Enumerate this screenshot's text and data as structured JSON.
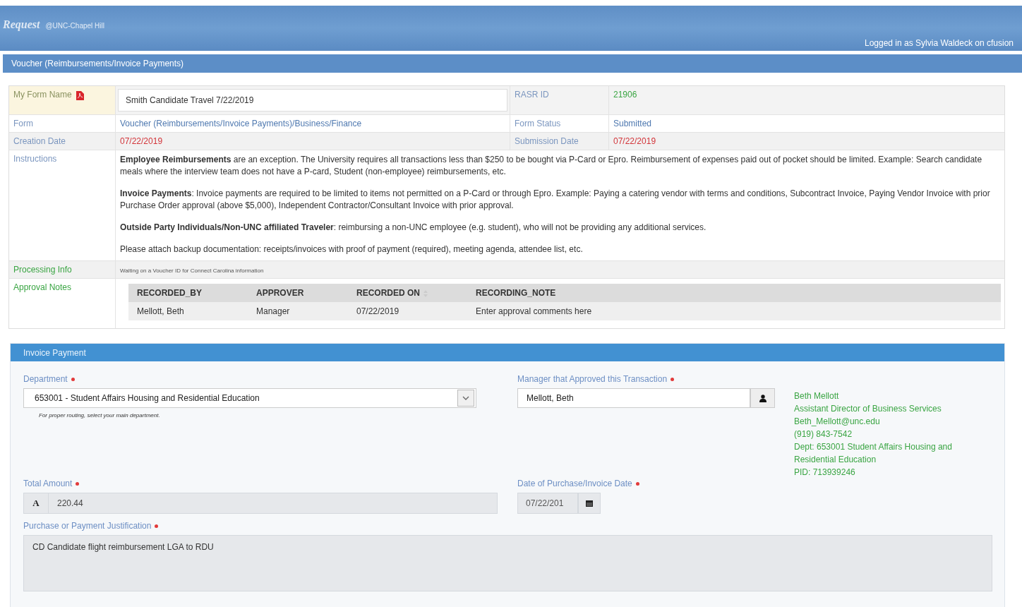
{
  "header": {
    "title": "Request",
    "subtitle": "@UNC-Chapel Hill",
    "user_status": "Logged in as Sylvia Waldeck on cfusion"
  },
  "page_title": "Voucher (Reimbursements/Invoice Payments)",
  "form_info": {
    "my_form_name": {
      "label": "My Form Name",
      "value": "Smith Candidate Travel 7/22/2019"
    },
    "rasr_id": {
      "label": "RASR ID",
      "value": "21906"
    },
    "form": {
      "label": "Form",
      "value": "Voucher (Reimbursements/Invoice Payments)/Business/Finance"
    },
    "form_status": {
      "label": "Form Status",
      "value": "Submitted"
    },
    "creation_date": {
      "label": "Creation Date",
      "value": "07/22/2019"
    },
    "submission_date": {
      "label": "Submission Date",
      "value": "07/22/2019"
    },
    "instructions": {
      "label": "Instructions",
      "paragraphs": [
        "**Employee Reimbursements** are an exception.  The University requires all transactions less than $250 to be bought via P-Card or Epro.   Reimbursement of expenses paid out of pocket should be limited.  Example: Search candidate meals where the interview team does not have a P-card, Student (non-employee) reimbursements, etc.",
        "**Invoice Payments**: Invoice payments are required to be limited to items not permitted on a P-Card or through Epro.  Example: Paying a catering vendor with terms and conditions, Subcontract Invoice, Paying Vendor Invoice with prior Purchase Order approval (above $5,000), Independent Contractor/Consultant Invoice with prior approval.",
        "**Outside Party Individuals/Non-UNC affiliated Traveler**: reimbursing a non-UNC employee (e.g. student), who will not be providing any additional services.",
        "Please attach backup documentation: receipts/invoices with proof of payment (required), meeting agenda, attendee list, etc."
      ]
    },
    "processing_info": {
      "label": "Processing Info",
      "value": "Waiting on a Voucher ID for Connect Carolina information"
    },
    "approval_notes": {
      "label": "Approval Notes",
      "columns": [
        {
          "label": "RECORDED_BY",
          "sortable": false
        },
        {
          "label": "APPROVER",
          "sortable": false
        },
        {
          "label": "RECORDED ON",
          "sortable": true
        },
        {
          "label": "RECORDING_NOTE",
          "sortable": false
        }
      ],
      "rows": [
        [
          "Mellott, Beth",
          "Manager",
          "07/22/2019",
          "Enter approval comments here"
        ]
      ]
    }
  },
  "invoice_payment": {
    "title": "Invoice Payment",
    "department": {
      "label": "Department",
      "required": true,
      "value": "653001 - Student Affairs Housing and Residential Education",
      "help": "For proper routing, select your main department."
    },
    "manager": {
      "label": "Manager that Approved this Transaction",
      "required": true,
      "value": "Mellott, Beth"
    },
    "manager_details": [
      "Beth Mellott",
      "Assistant Director of Business Services",
      "Beth_Mellott@unc.edu",
      "(919) 843-7542",
      "Dept: 653001 Student Affairs Housing and Residential Education",
      "PID: 713939246"
    ],
    "total_amount": {
      "label": "Total Amount",
      "required": true,
      "prefix": "A",
      "value": "220.44"
    },
    "purchase_date": {
      "label": "Date of Purchase/Invoice Date",
      "required": true,
      "value": "07/22/201"
    },
    "justification": {
      "label": "Purchase or Payment Justification",
      "required": true,
      "value": "CD Candidate flight reimbursement LGA to RDU"
    }
  }
}
